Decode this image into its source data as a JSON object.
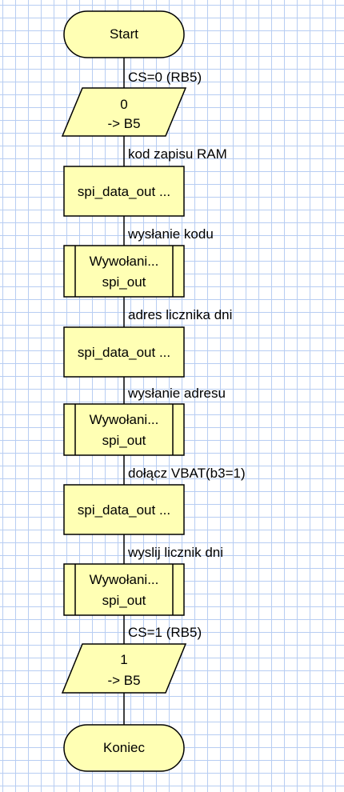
{
  "flowchart": {
    "start": {
      "label": "Start"
    },
    "edges": [
      "CS=0 (RB5)",
      "kod zapisu RAM",
      "wysłanie kodu",
      "adres licznika dni",
      "wysłanie adresu",
      "dołącz VBAT(b3=1)",
      "wyslij licznik dni",
      "CS=1 (RB5)"
    ],
    "output1": {
      "line1": "0",
      "line2": "-> B5"
    },
    "assign1": {
      "label": "spi_data_out ..."
    },
    "call1": {
      "line1": "Wywołani...",
      "line2": "spi_out"
    },
    "assign2": {
      "label": "spi_data_out ..."
    },
    "call2": {
      "line1": "Wywołani...",
      "line2": "spi_out"
    },
    "assign3": {
      "label": "spi_data_out ..."
    },
    "call3": {
      "line1": "Wywołani...",
      "line2": "spi_out"
    },
    "output2": {
      "line1": "1",
      "line2": "-> B5"
    },
    "end": {
      "label": "Koniec"
    }
  },
  "colors": {
    "node_fill": "#ffffb4",
    "grid": "#b8cdf2",
    "stroke": "#000000"
  }
}
